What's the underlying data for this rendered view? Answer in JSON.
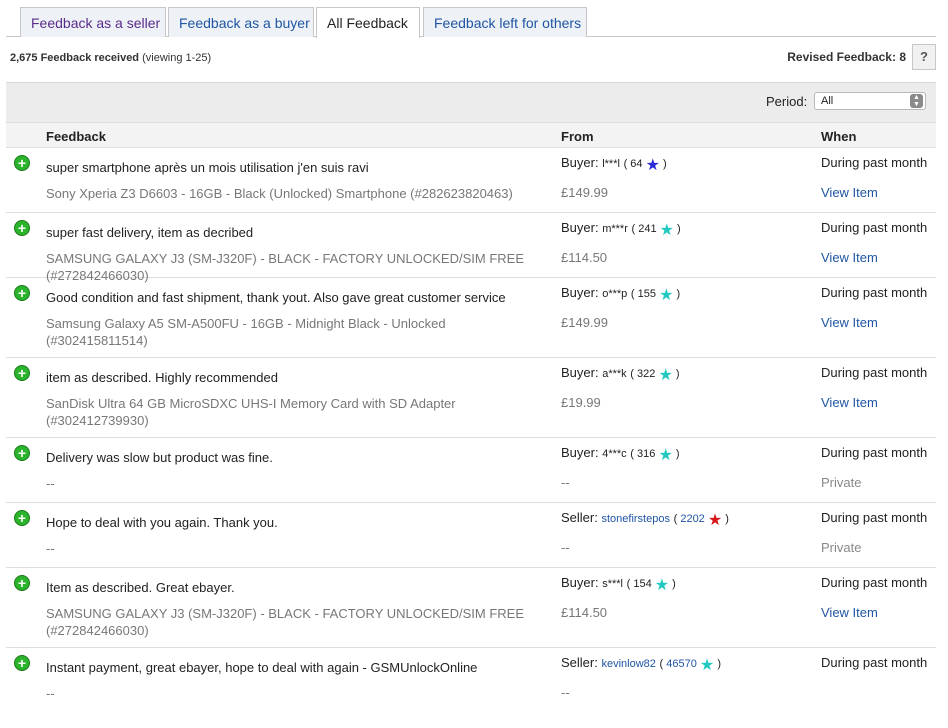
{
  "tabs": [
    {
      "label": "Feedback as a seller"
    },
    {
      "label": "Feedback as a buyer"
    },
    {
      "label": "All Feedback"
    },
    {
      "label": "Feedback left for others"
    }
  ],
  "summary": {
    "count": "2,675 Feedback received",
    "viewing": "(viewing 1-25)"
  },
  "revised": {
    "label": "Revised Feedback: 8"
  },
  "help_label": "?",
  "period": {
    "label": "Period:",
    "selected": "All"
  },
  "columns": {
    "feedback": "Feedback",
    "from": "From",
    "when": "When"
  },
  "colors": {
    "purple_star": "#2a2ad8",
    "turquoise_star": "#23c9c1",
    "red_star": "#d8161a",
    "positive": "#2bb32b",
    "link": "#1f55a3"
  },
  "rows": [
    {
      "comment": "super smartphone après un mois utilisation j'en suis ravi",
      "item": "Sony Xperia Z3 D6603 - 16GB - Black (Unlocked) Smartphone (#282623820463)",
      "role": "Buyer:",
      "user": "l***l",
      "score": "64",
      "star_icon": "purple-star-icon",
      "price": "£149.99",
      "when": "During past month",
      "view": "View Item"
    },
    {
      "comment": "super fast delivery, item as decribed",
      "item": "SAMSUNG GALAXY J3 (SM-J320F) - BLACK - FACTORY UNLOCKED/SIM FREE (#272842466030)",
      "role": "Buyer:",
      "user": "m***r",
      "score": "241",
      "star_icon": "turquoise-star-icon",
      "price": "£114.50",
      "when": "During past month",
      "view": "View Item"
    },
    {
      "comment": "Good condition and fast shipment, thank yout. Also gave great customer service",
      "item": "Samsung Galaxy A5 SM-A500FU - 16GB - Midnight Black - Unlocked (#302415811514)",
      "role": "Buyer:",
      "user": "o***p",
      "score": "155",
      "star_icon": "turquoise-star-icon",
      "price": "£149.99",
      "when": "During past month",
      "view": "View Item"
    },
    {
      "comment": "item as described. Highly recommended",
      "item": "SanDisk Ultra 64 GB MicroSDXC UHS-I Memory Card with SD Adapter (#302412739930)",
      "role": "Buyer:",
      "user": "a***k",
      "score": "322",
      "star_icon": "turquoise-star-icon",
      "price": "£19.99",
      "when": "During past month",
      "view": "View Item"
    },
    {
      "comment": "Delivery was slow but product was fine.",
      "item": "--",
      "role": "Buyer:",
      "user": "4***c",
      "score": "316",
      "star_icon": "turquoise-star-icon",
      "price": "--",
      "when": "During past month",
      "view": "Private"
    },
    {
      "comment": "Hope to deal with you again. Thank you.",
      "item": "--",
      "role": "Seller:",
      "user": "stonefirstepos",
      "score": "2202",
      "star_icon": "red-star-icon",
      "price": "--",
      "when": "During past month",
      "view": "Private"
    },
    {
      "comment": "Item as described. Great ebayer.",
      "item": "SAMSUNG GALAXY J3 (SM-J320F) - BLACK - FACTORY UNLOCKED/SIM FREE (#272842466030)",
      "role": "Buyer:",
      "user": "s***l",
      "score": "154",
      "star_icon": "turquoise-star-icon",
      "price": "£114.50",
      "when": "During past month",
      "view": "View Item"
    },
    {
      "comment": "Instant payment, great ebayer, hope to deal with again - GSMUnlockOnline",
      "item": "--",
      "role": "Seller:",
      "user": "kevinlow82",
      "score": "46570",
      "star_icon": "turquoise-shooting-star-icon",
      "price": "--",
      "when": "During past month",
      "view": ""
    }
  ]
}
